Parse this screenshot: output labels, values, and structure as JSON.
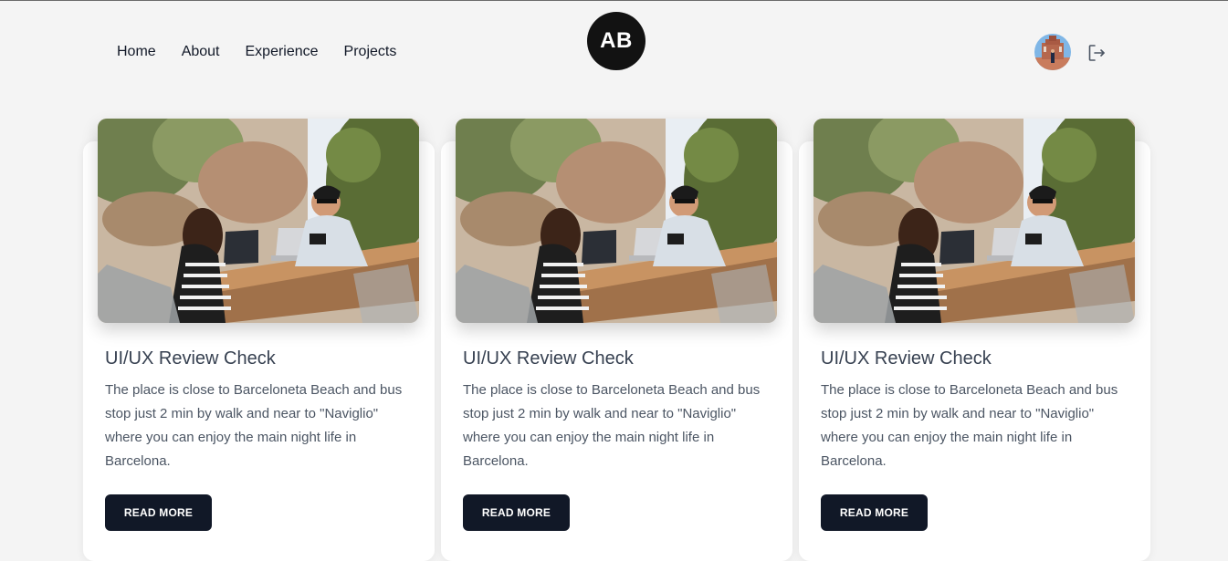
{
  "nav": {
    "items": [
      "Home",
      "About",
      "Experience",
      "Projects"
    ],
    "logo_text": "AB"
  },
  "header_right": {
    "avatar": "user-avatar",
    "logout_icon": "logout-icon"
  },
  "cards": [
    {
      "title": "UI/UX Review Check",
      "text": "The place is close to Barceloneta Beach and bus stop just 2 min by walk and near to \"Naviglio\" where you can enjoy the main night life in Barcelona.",
      "button": "READ MORE"
    },
    {
      "title": "UI/UX Review Check",
      "text": "The place is close to Barceloneta Beach and bus stop just 2 min by walk and near to \"Naviglio\" where you can enjoy the main night life in Barcelona.",
      "button": "READ MORE"
    },
    {
      "title": "UI/UX Review Check",
      "text": "The place is close to Barceloneta Beach and bus stop just 2 min by walk and near to \"Naviglio\" where you can enjoy the main night life in Barcelona.",
      "button": "READ MORE"
    }
  ],
  "colors": {
    "background": "#f4f4f4",
    "logo_bg": "#121212",
    "button_bg": "#111827",
    "card_bg": "#ffffff"
  }
}
